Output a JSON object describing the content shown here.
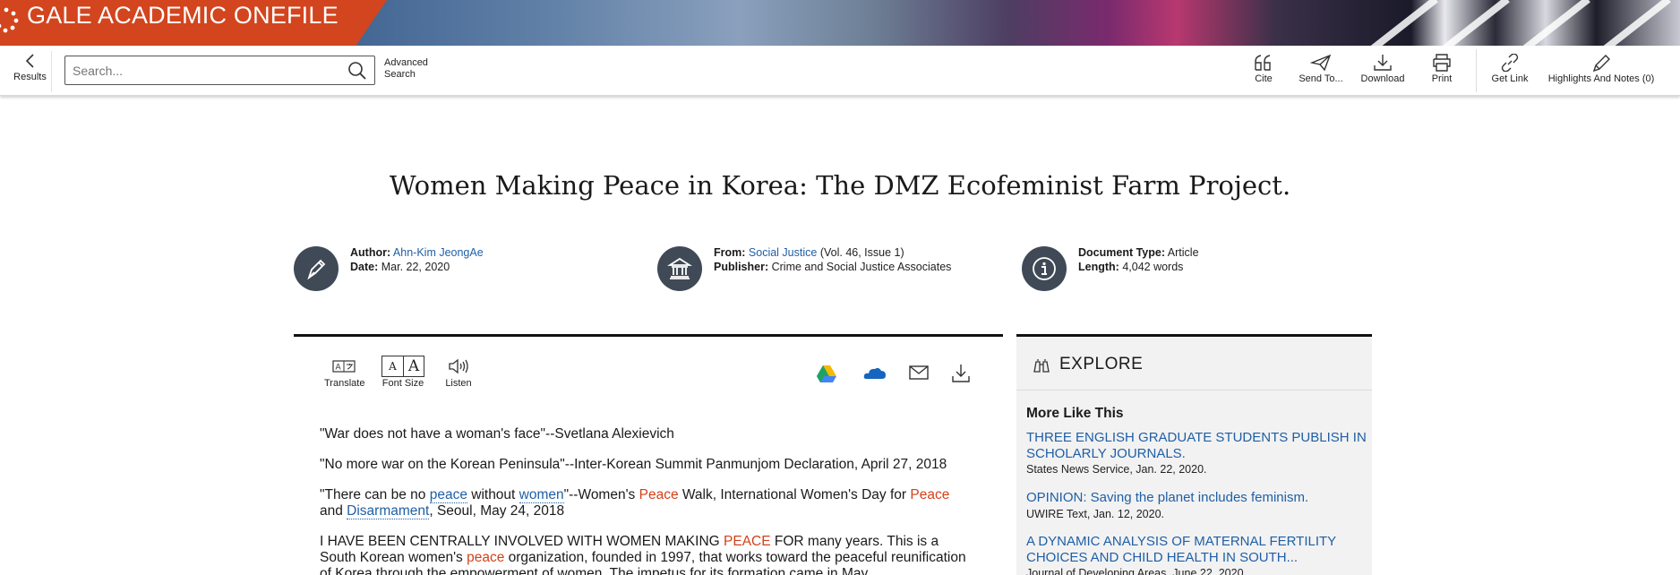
{
  "banner": {
    "title": "GALE ACADEMIC ONEFILE"
  },
  "toolbar": {
    "results_label": "Results",
    "search_placeholder": "Search...",
    "advanced_search_line1": "Advanced",
    "advanced_search_line2": "Search",
    "tools": [
      {
        "label": "Cite",
        "icon": "quote-icon"
      },
      {
        "label": "Send To...",
        "icon": "paper-plane-icon"
      },
      {
        "label": "Download",
        "icon": "download-icon"
      },
      {
        "label": "Print",
        "icon": "printer-icon"
      },
      {
        "label": "Get Link",
        "icon": "link-icon"
      },
      {
        "label": "Highlights And Notes (0)",
        "icon": "pen-icon"
      }
    ]
  },
  "document": {
    "title": "Women Making Peace in Korea: The DMZ Ecofeminist Farm Project.",
    "author_label": "Author:",
    "author": "Ahn-Kim JeongAe",
    "date_label": "Date:",
    "date": "Mar. 22, 2020",
    "from_label": "From:",
    "from_source": "Social Justice",
    "from_issue": "(Vol. 46, Issue 1)",
    "publisher_label": "Publisher:",
    "publisher": "Crime and Social Justice Associates",
    "doctype_label": "Document Type:",
    "doctype": "Article",
    "length_label": "Length:",
    "length": "4,042 words"
  },
  "article_tools": {
    "translate": "Translate",
    "font_size": "Font Size",
    "font_small": "A",
    "font_large": "A",
    "listen": "Listen"
  },
  "article": {
    "quote1": "\"War does not have a woman's face\"--Svetlana Alexievich",
    "quote2": "\"No more war on the Korean Peninsula\"--Inter-Korean Summit Panmunjom Declaration, April 27, 2018",
    "q3_a": "\"There can be no ",
    "q3_peace": "peace",
    "q3_b": " without ",
    "q3_women": "women",
    "q3_c": "\"--Women's ",
    "q3_peace2": "Peace",
    "q3_d": " Walk, International Women's Day for ",
    "q3_peace3": "Peace",
    "q3_e": " and ",
    "q3_disarm": "Disarmament",
    "q3_f": ", Seoul, May 24, 2018",
    "p1_a": "I HAVE BEEN CENTRALLY INVOLVED WITH WOMEN MAKING ",
    "p1_peace": "PEACE",
    "p1_b": " FOR many years. This is a South Korean women's ",
    "p1_peace2": "peace",
    "p1_c": " organization, founded in 1997, that works toward the peaceful reunification of Korea through the empowerment of women. The impetus for its formation came in May"
  },
  "explore": {
    "heading": "EXPLORE",
    "more_like_this": "More Like This",
    "items": [
      {
        "title": "THREE ENGLISH GRADUATE STUDENTS PUBLISH IN SCHOLARLY JOURNALS.",
        "source": "States News Service, Jan. 22, 2020."
      },
      {
        "title": "OPINION: Saving the planet includes feminism.",
        "source": "UWIRE Text, Jan. 12, 2020."
      },
      {
        "title": "A DYNAMIC ANALYSIS OF MATERNAL FERTILITY CHOICES AND CHILD HEALTH IN SOUTH...",
        "source": "Journal of Developing Areas, June 22, 2020."
      }
    ]
  },
  "colors": {
    "brand": "#d2451e",
    "link": "#1f5fa6",
    "highlight": "#d4401a",
    "icon_circle": "#3f4a56"
  }
}
